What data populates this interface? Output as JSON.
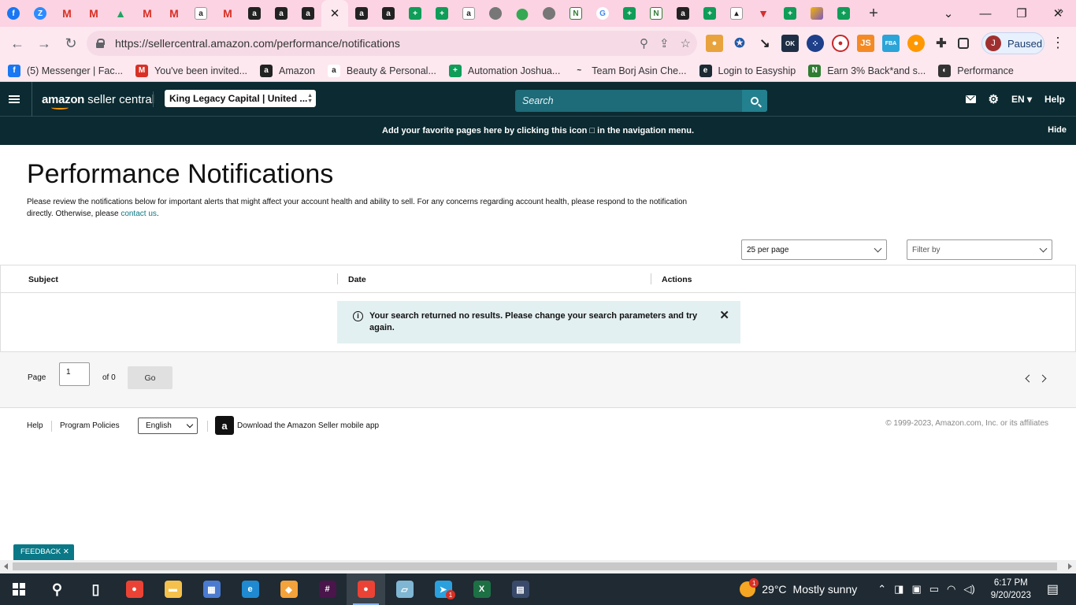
{
  "browser": {
    "tabs": [
      {
        "icon": "facebook-icon",
        "glyph": "f"
      },
      {
        "icon": "zoom-icon",
        "glyph": "Z"
      },
      {
        "icon": "gmail-icon",
        "glyph": "M"
      },
      {
        "icon": "gmail-icon",
        "glyph": "M"
      },
      {
        "icon": "google-drive-icon",
        "glyph": "▲"
      },
      {
        "icon": "gmail-icon",
        "glyph": "M"
      },
      {
        "icon": "gmail-icon",
        "glyph": "M"
      },
      {
        "icon": "amazon-icon",
        "glyph": "a"
      },
      {
        "icon": "gmail-icon",
        "glyph": "M"
      },
      {
        "icon": "amazon-seller-icon",
        "glyph": "a"
      },
      {
        "icon": "amazon-seller-icon",
        "glyph": "a"
      },
      {
        "icon": "amazon-seller-icon",
        "glyph": "a"
      },
      {
        "icon": "close-icon",
        "glyph": "✕",
        "active": true
      },
      {
        "icon": "amazon-seller-icon",
        "glyph": "a"
      },
      {
        "icon": "amazon-seller-icon",
        "glyph": "a"
      },
      {
        "icon": "google-sheets-icon",
        "glyph": "+"
      },
      {
        "icon": "google-sheets-icon",
        "glyph": "+"
      },
      {
        "icon": "amazon-icon",
        "glyph": "a"
      },
      {
        "icon": "globe-icon",
        "glyph": ""
      },
      {
        "icon": "google-maps-icon",
        "glyph": "⬤"
      },
      {
        "icon": "globe-icon",
        "glyph": ""
      },
      {
        "icon": "n-app-icon",
        "glyph": "N"
      },
      {
        "icon": "google-icon",
        "glyph": "G"
      },
      {
        "icon": "google-sheets-icon",
        "glyph": "+"
      },
      {
        "icon": "n-app-icon",
        "glyph": "N"
      },
      {
        "icon": "amazon-seller-icon",
        "glyph": "a"
      },
      {
        "icon": "google-sheets-icon",
        "glyph": "+"
      },
      {
        "icon": "photo-icon",
        "glyph": "▴"
      },
      {
        "icon": "vivaldi-icon",
        "glyph": "▼"
      },
      {
        "icon": "google-sheets-icon",
        "glyph": "+"
      },
      {
        "icon": "multicolor-app-icon",
        "glyph": ""
      },
      {
        "icon": "google-sheets-icon",
        "glyph": "+"
      }
    ],
    "new_tab": "+",
    "minimize": "—",
    "restore": "❐",
    "close": "✕",
    "tab_search": "⌄",
    "url": "https://sellercentral.amazon.com/performance/notifications",
    "profile_initial": "J",
    "profile_label": "Paused",
    "bookmarks": [
      {
        "label": "(5) Messenger | Fac...",
        "icon": "facebook-icon",
        "glyph": "f",
        "color": "#1877f2"
      },
      {
        "label": "You've been invited...",
        "icon": "gmail-icon",
        "glyph": "M",
        "color": "#d93025"
      },
      {
        "label": "Amazon",
        "icon": "amazon-seller-icon",
        "glyph": "a",
        "color": "#222222"
      },
      {
        "label": "Beauty & Personal...",
        "icon": "amazon-icon",
        "glyph": "a",
        "color": "#ffffff"
      },
      {
        "label": "Automation Joshua...",
        "icon": "google-sheets-icon",
        "glyph": "+",
        "color": "#0f9d58"
      },
      {
        "label": "Team Borj Asin Che...",
        "icon": "wave-icon",
        "glyph": "~",
        "color": "#fde8f0"
      },
      {
        "label": "Login to Easyship",
        "icon": "easyship-icon",
        "glyph": "e",
        "color": "#1b2a33"
      },
      {
        "label": "Earn 3% Back*and s...",
        "icon": "n-app-icon",
        "glyph": "N",
        "color": "#2e7d32"
      },
      {
        "label": "Performance",
        "icon": "globe-icon",
        "glyph": "◐",
        "color": "#333333"
      }
    ]
  },
  "header": {
    "logo_bold": "amazon",
    "logo_rest": "seller central",
    "store": "King Legacy Capital | United ...",
    "search_placeholder": "Search",
    "language": "EN ▾",
    "help": "Help"
  },
  "banner": {
    "text": "Add your favorite pages here by clicking this icon □ in the navigation menu.",
    "hide": "Hide"
  },
  "main": {
    "title": "Performance Notifications",
    "description": "Please review the notifications below for important alerts that might affect your account health and ability to sell. For any concerns regarding account health, please respond to the notification directly. Otherwise, please",
    "contact_link": "contact us",
    "per_page": "25 per page",
    "filter_placeholder": "Filter by",
    "columns": [
      "Subject",
      "Date",
      "Actions"
    ],
    "alert": "Your search returned no results. Please change your search parameters and try again.",
    "pager": {
      "page_label": "Page",
      "page_value": "1",
      "of_label": "of 0",
      "go": "Go"
    }
  },
  "footer": {
    "help": "Help",
    "policies": "Program Policies",
    "language": "English",
    "download": "Download the Amazon Seller mobile app",
    "copyright": "© 1999-2023, Amazon.com, Inc. or its affiliates",
    "feedback": "FEEDBACK ✕"
  },
  "taskbar": {
    "apps": [
      {
        "name": "search-icon",
        "glyph": "⚲",
        "color": "transparent"
      },
      {
        "name": "task-view-icon",
        "glyph": "▯",
        "color": "transparent"
      },
      {
        "name": "chrome-icon",
        "glyph": "●",
        "color": "#ea4335"
      },
      {
        "name": "file-explorer-icon",
        "glyph": "▬",
        "color": "#f4c14c"
      },
      {
        "name": "computer-icon",
        "glyph": "▦",
        "color": "#4a7bd0"
      },
      {
        "name": "edge-icon",
        "glyph": "e",
        "color": "#1f8ad1"
      },
      {
        "name": "vpn-icon",
        "glyph": "◆",
        "color": "#f4a23a"
      },
      {
        "name": "slack-icon",
        "glyph": "#",
        "color": "#4a154b"
      },
      {
        "name": "chrome-profile-icon",
        "glyph": "●",
        "color": "#ea4335",
        "active": true
      },
      {
        "name": "notepad-icon",
        "glyph": "▱",
        "color": "#7fb6d3"
      },
      {
        "name": "telegram-icon",
        "glyph": "➤",
        "color": "#2aa1de",
        "badge": "1"
      },
      {
        "name": "excel-icon",
        "glyph": "X",
        "color": "#1d7044"
      },
      {
        "name": "calculator-icon",
        "glyph": "▤",
        "color": "#3a4a6a"
      }
    ],
    "weather_badge": "1",
    "temperature": "29°C",
    "weather": "Mostly sunny",
    "time": "6:17 PM",
    "date": "9/20/2023"
  }
}
